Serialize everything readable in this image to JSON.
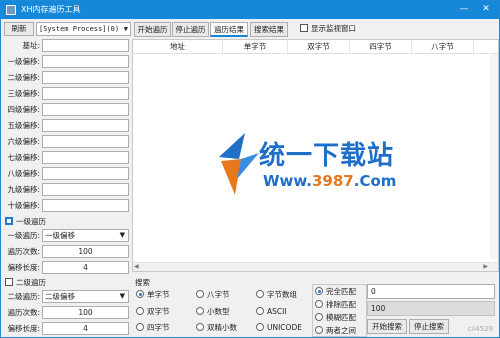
{
  "window": {
    "title": "XH内存遍历工具",
    "min": "—",
    "close": "✕"
  },
  "left": {
    "refresh_label": "刷新",
    "process_value": "[System Process](0)",
    "base_label": "基址:",
    "offsets": [
      {
        "label": "一级偏移:",
        "value": ""
      },
      {
        "label": "二级偏移:",
        "value": ""
      },
      {
        "label": "三级偏移:",
        "value": ""
      },
      {
        "label": "四级偏移:",
        "value": ""
      },
      {
        "label": "五级偏移:",
        "value": ""
      },
      {
        "label": "六级偏移:",
        "value": ""
      },
      {
        "label": "七级偏移:",
        "value": ""
      },
      {
        "label": "八级偏移:",
        "value": ""
      },
      {
        "label": "九级偏移:",
        "value": ""
      },
      {
        "label": "十级偏移:",
        "value": ""
      }
    ],
    "level1": {
      "checkbox_label": "一级遍历",
      "checked": true,
      "mode_label": "一级遍历:",
      "mode_value": "一级偏移",
      "count_label": "遍历次数:",
      "count_value": "100",
      "length_label": "偏移长度:",
      "length_value": "4"
    },
    "level2": {
      "checkbox_label": "二级遍历",
      "checked": false,
      "mode_label": "二级遍历:",
      "mode_value": "二级偏移",
      "count_label": "遍历次数:",
      "count_value": "100",
      "length_label": "偏移长度:",
      "length_value": "4"
    }
  },
  "toolbar": {
    "tabs": [
      {
        "label": "开始遍历",
        "active": false
      },
      {
        "label": "停止遍历",
        "active": false
      },
      {
        "label": "遍历结果",
        "active": true
      },
      {
        "label": "搜索结果",
        "active": false
      }
    ],
    "monitor_label": "显示监视窗口"
  },
  "list": {
    "columns": [
      "地址",
      "单字节",
      "双字节",
      "四字节",
      "八字节"
    ]
  },
  "watermark": {
    "cn": "统一下载站",
    "url_pre": "Www.",
    "url_num": "3987",
    "url_post": ".Com"
  },
  "search": {
    "header": "搜索",
    "types": [
      {
        "label": "单字节",
        "checked": true
      },
      {
        "label": "八字节",
        "checked": false
      },
      {
        "label": "字节数组",
        "checked": false
      },
      {
        "label": "双字节",
        "checked": false
      },
      {
        "label": "小数型",
        "checked": false
      },
      {
        "label": "ASCII",
        "checked": false
      },
      {
        "label": "四字节",
        "checked": false
      },
      {
        "label": "双精小数",
        "checked": false
      },
      {
        "label": "UNICODE",
        "checked": false
      }
    ],
    "match": [
      {
        "label": "完全匹配",
        "checked": true
      },
      {
        "label": "排除匹配",
        "checked": false
      },
      {
        "label": "模糊匹配",
        "checked": false
      },
      {
        "label": "两者之间",
        "checked": false
      }
    ],
    "value": "0",
    "result_value": "100",
    "start_label": "开始搜索",
    "stop_label": "停止搜索"
  },
  "corner_text": "cii4529",
  "colors": {
    "titlebar": "#1787d8",
    "accent": "#1e7ad6",
    "watermark_blue": "#1f6ec8",
    "watermark_orange": "#e6781e"
  }
}
